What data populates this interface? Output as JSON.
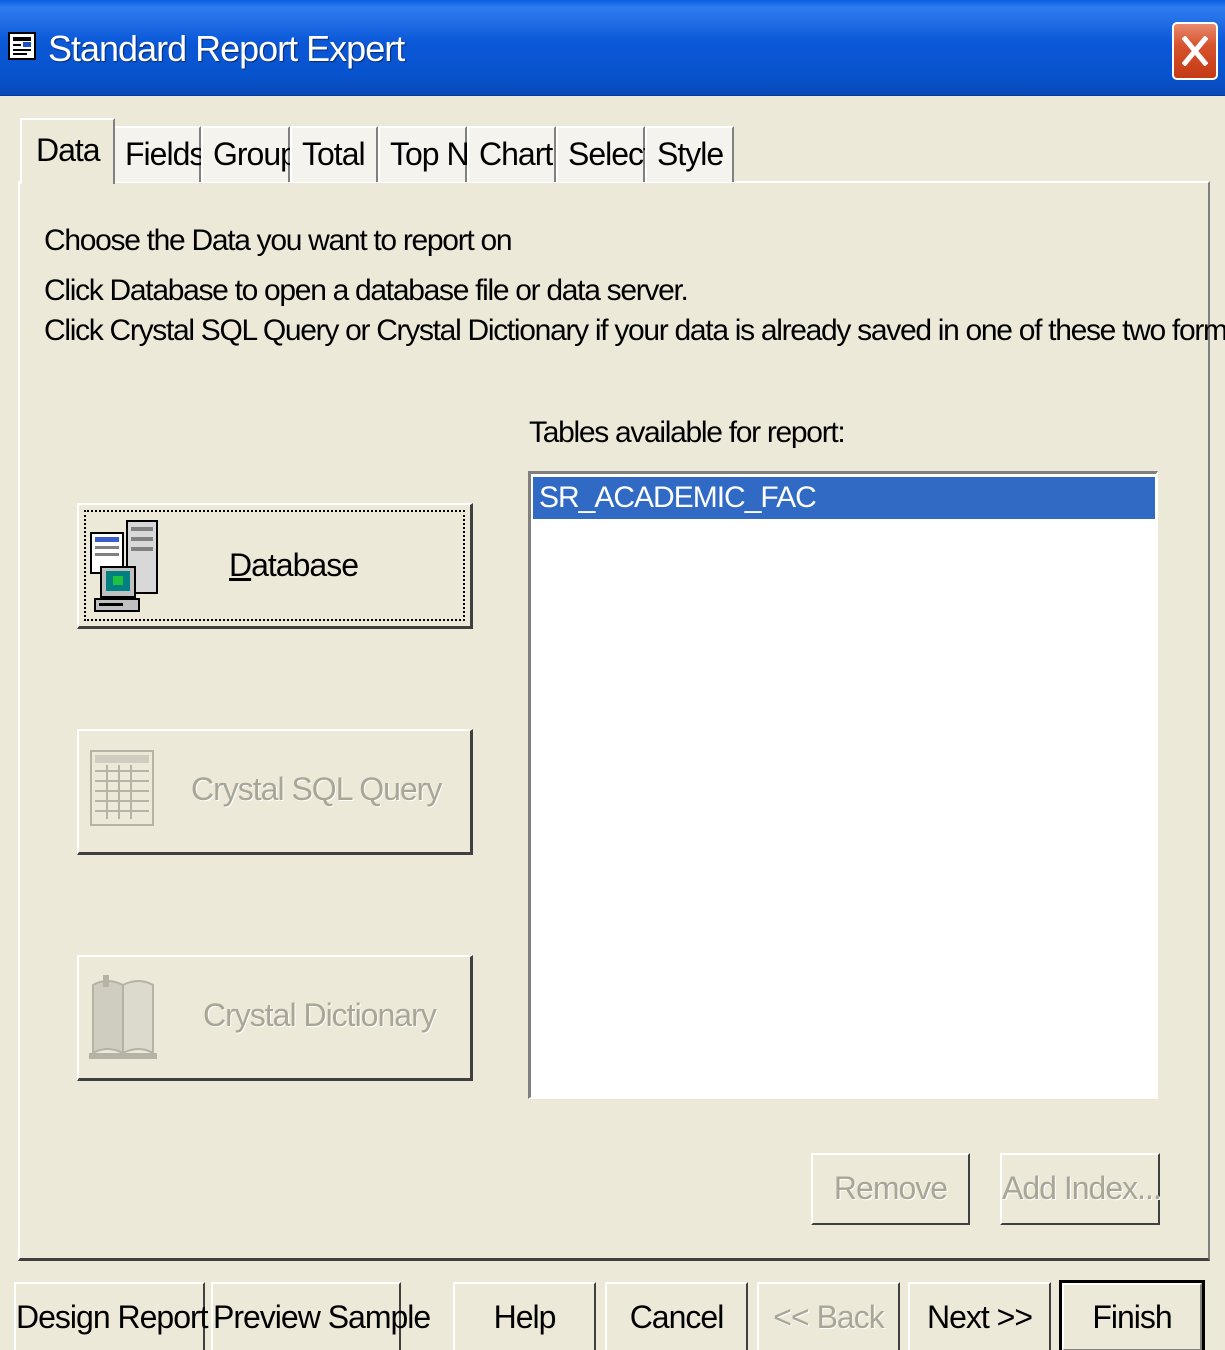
{
  "window": {
    "title": "Standard Report Expert"
  },
  "tabs": [
    {
      "label": "Data",
      "active": true
    },
    {
      "label": "Fields"
    },
    {
      "label": "Group"
    },
    {
      "label": "Total"
    },
    {
      "label": "Top N"
    },
    {
      "label": "Chart"
    },
    {
      "label": "Select"
    },
    {
      "label": "Style"
    }
  ],
  "instructions": {
    "line1": "Choose the Data you want to report on",
    "line2": "Click Database to open a database file or data server.",
    "line3": "Click Crystal SQL Query or Crystal Dictionary if your data is already saved in one of these two formats."
  },
  "source_buttons": {
    "database": "Database",
    "sql_query": "Crystal SQL Query",
    "dictionary": "Crystal Dictionary"
  },
  "tables": {
    "label": "Tables available for report:",
    "items": [
      "SR_ACADEMIC_FAC"
    ],
    "remove": "Remove",
    "add_index": "Add Index..."
  },
  "footer": {
    "design_report": "Design Report",
    "preview_sample": "Preview Sample",
    "help": "Help",
    "cancel": "Cancel",
    "back": "<< Back",
    "next": "Next >>",
    "finish": "Finish"
  },
  "colors": {
    "titlebar": "#0b58d8",
    "selection": "#316ac5",
    "face": "#ece9d8",
    "close": "#d6532e"
  }
}
